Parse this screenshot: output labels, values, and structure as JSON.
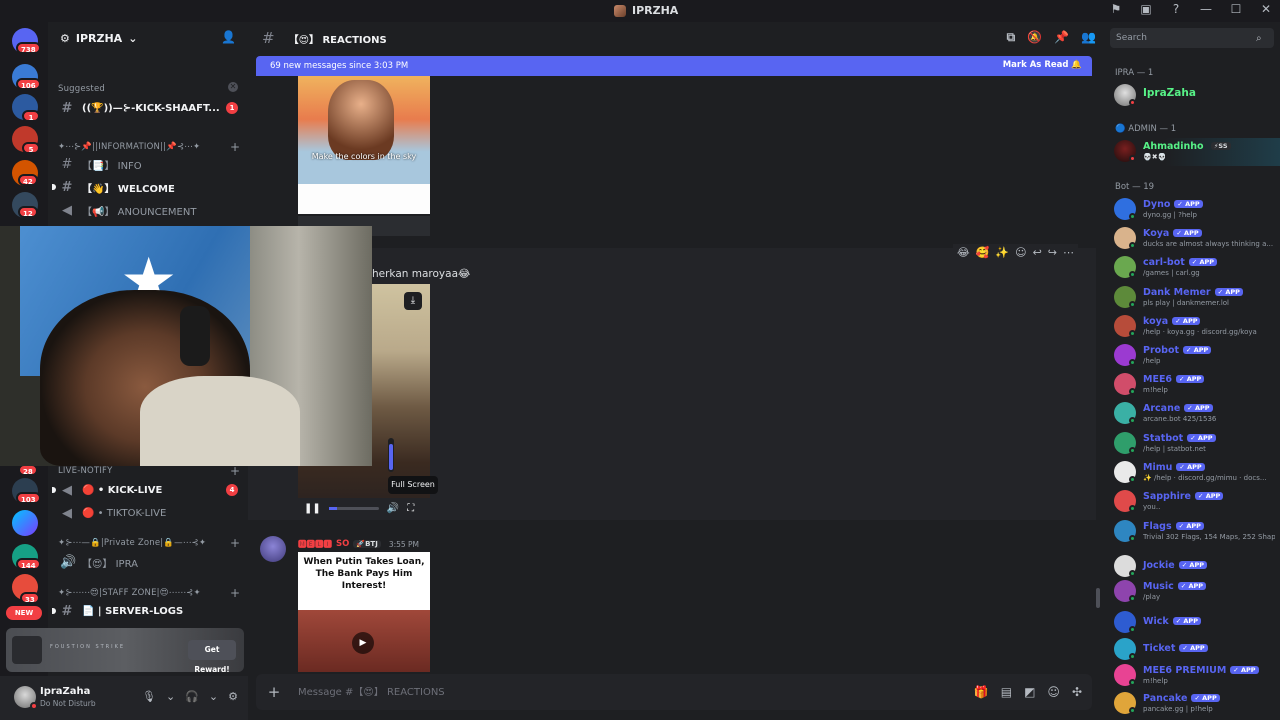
{
  "window": {
    "title": "IPRZHA"
  },
  "rail": {
    "badges": [
      "738",
      "106",
      "1",
      "5",
      "42",
      "12",
      "28",
      "103",
      "144",
      "33"
    ],
    "new_label": "NEW"
  },
  "sidebar": {
    "guild_name": "IPRZHA",
    "suggested_label": "Suggested",
    "suggested_channel": "((🏆))—⊱-KICK-SHAAFT...",
    "suggested_count": "1",
    "cat_information": "✦⋯⊱📌||INFORMATION||📌⊰⋯✦",
    "ch_info": "【📑】 INFO",
    "ch_welcome": "【👋】 WELCOME",
    "ch_announcement": "【📢】 ANOUNCEMENT",
    "cat_live": "LIVE-NOTIFY",
    "ch_kick": "🔴 • KICK-LIVE",
    "ch_kick_count": "4",
    "ch_tiktok": "🔴 • TIKTOK-LIVE",
    "cat_private": "✦⊱⋯—🔒|Private Zone|🔒—⋯⊰✦",
    "ch_ipra": "【😍】 IPRA",
    "cat_staff": "✦⊱⋯⋯😍|STAFF ZONE|😍⋯⋯⊰✦",
    "ch_serverlogs": "📄 | SERVER-LOGS",
    "reward_text": "FOUSTION STRIKE",
    "reward_button": "Get Reward!",
    "user_name": "IpraZaha",
    "user_status": "Do Not Disturb"
  },
  "main": {
    "channel_title": "【😍】 REACTIONS",
    "banner_text": "69 new messages since 3:03 PM",
    "banner_action": "Mark As Read",
    "gif_caption": "Make the colors in the sky",
    "message_text": "herkan maroyaa😂",
    "tooltip": "Full Screen",
    "msg3_name": "🅼🅴🅻🅸",
    "msg3_tag": "SO",
    "msg3_badge": "🚀BTJ",
    "msg3_time": "3:55 PM",
    "meme_caption": "When Putin Takes Loan, The Bank Pays Him Interest!",
    "composer_placeholder": "Message #【😍】 REACTIONS"
  },
  "members": {
    "search_placeholder": "Search",
    "group_ipra": "IPRA — 1",
    "group_admin": "ADMIN — 1",
    "group_bot": "Bot — 19",
    "owner_name": "IpraZaha",
    "admin_name": "Ahmadinho",
    "admin_tag": "⚡SS",
    "admin_sub": "💀✖💀",
    "app_label": "✓ APP",
    "bots": [
      {
        "name": "Dyno",
        "sub": "dyno.gg | ?help",
        "color": "#2f6fe0"
      },
      {
        "name": "Koya",
        "sub": "ducks are almost always thinking a...",
        "color": "#d9b38c"
      },
      {
        "name": "carl-bot",
        "sub": "/games | carl.gg",
        "color": "#6aa84f"
      },
      {
        "name": "Dank Memer",
        "sub": "pls play | dankmemer.lol",
        "color": "#5d8a3a"
      },
      {
        "name": "koya",
        "sub": "/help · koya.gg · discord.gg/koya",
        "color": "#b74c3a"
      },
      {
        "name": "Probot",
        "sub": "/help",
        "color": "#9b3ad1"
      },
      {
        "name": "MEE6",
        "sub": "m!help",
        "color": "#d14d6a"
      },
      {
        "name": "Arcane",
        "sub": "arcane.bot 425/1536",
        "color": "#3ab0a5"
      },
      {
        "name": "Statbot",
        "sub": "/help | statbot.net",
        "color": "#2f9e6b"
      },
      {
        "name": "Mimu",
        "sub": "✨ /help · discord.gg/mimu · docs...",
        "color": "#e9e9e9"
      },
      {
        "name": "Sapphire",
        "sub": "you..",
        "color": "#e04a4a"
      },
      {
        "name": "Flags",
        "sub": "Trivial 302 Flags, 154 Maps, 252 Shap",
        "color": "#2e86c1"
      },
      {
        "name": "Jockie",
        "sub": "",
        "color": "#dcdcdc"
      },
      {
        "name": "Music",
        "sub": "/play",
        "color": "#8e44ad"
      },
      {
        "name": "Wick",
        "sub": "",
        "color": "#2e5cd1"
      },
      {
        "name": "Ticket",
        "sub": "",
        "color": "#2aa3c9"
      },
      {
        "name": "MEE6 PREMIUM",
        "sub": "m!help",
        "color": "#e84393"
      },
      {
        "name": "Pancake",
        "sub": "pancake.gg | p!help",
        "color": "#e0a53a"
      }
    ]
  }
}
